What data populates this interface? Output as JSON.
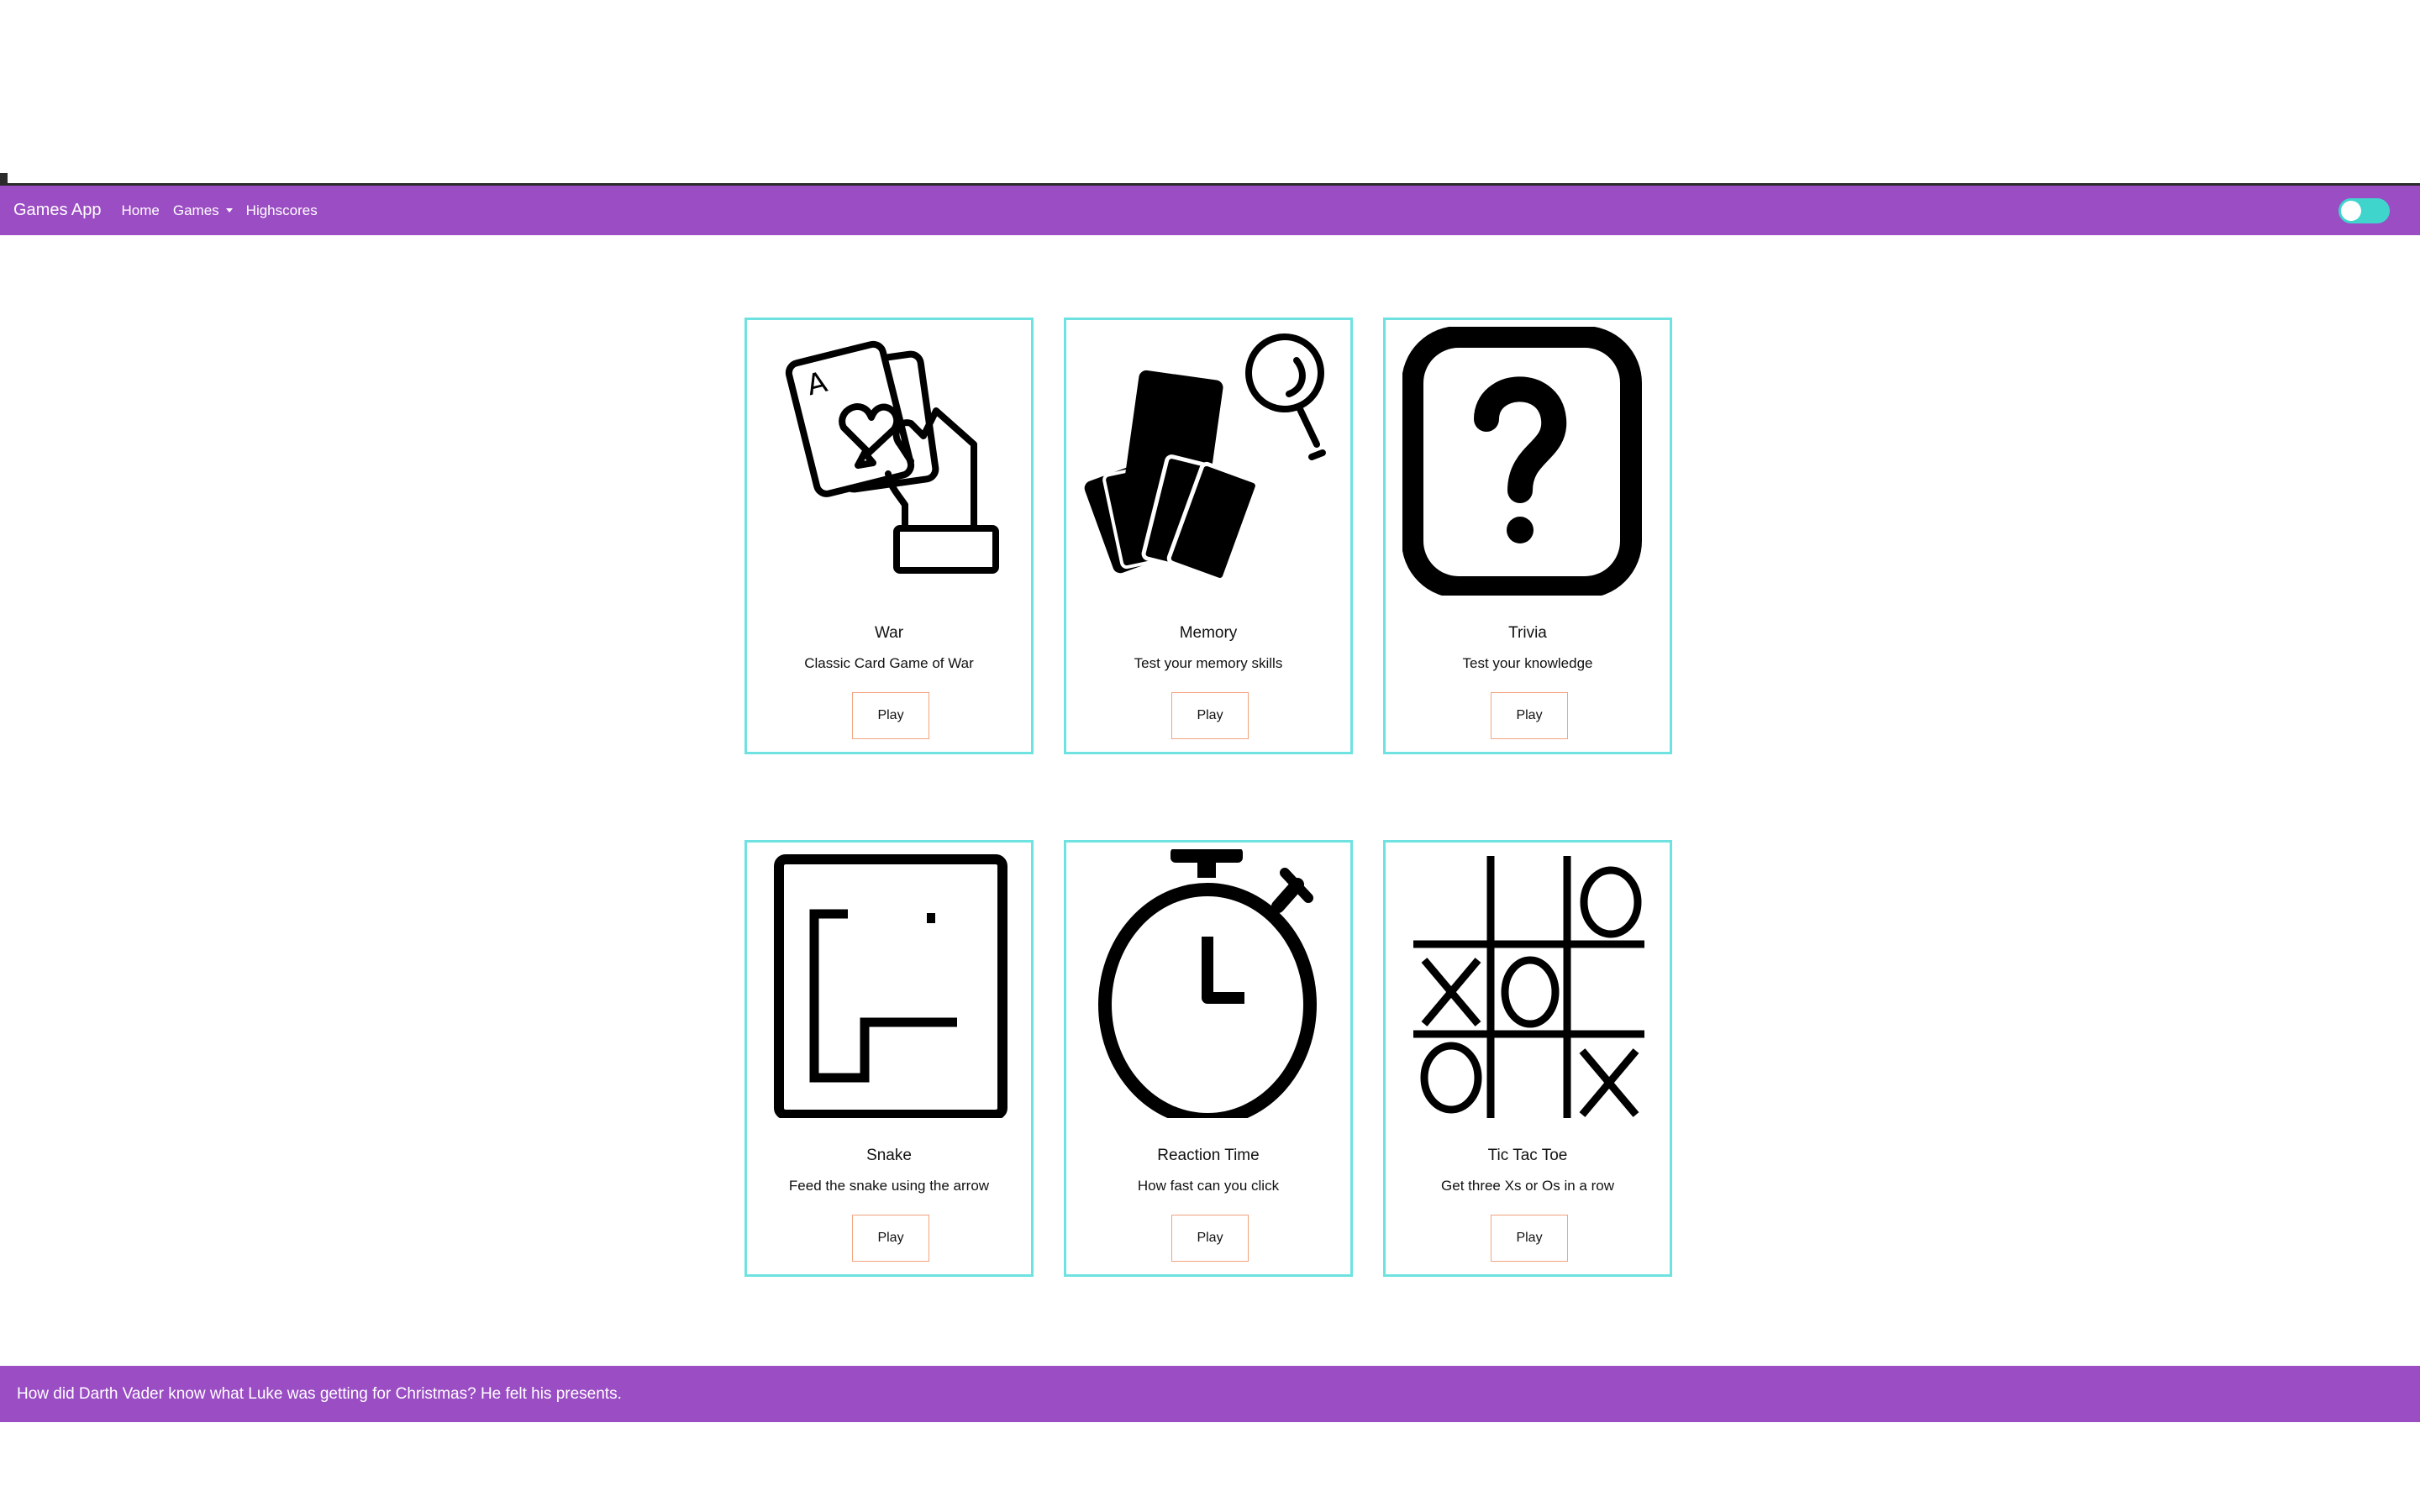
{
  "navbar": {
    "brand": "Games App",
    "links": [
      "Home",
      "Games",
      "Highscores"
    ],
    "accent_color": "#9b4dc4",
    "toggle_color": "#3fd4cc"
  },
  "cards": [
    {
      "title": "War",
      "description": "Classic Card Game of War",
      "button": "Play",
      "icon": "hand-holding-card-icon"
    },
    {
      "title": "Memory",
      "description": "Test your memory skills",
      "button": "Play",
      "icon": "cards-magnifier-icon"
    },
    {
      "title": "Trivia",
      "description": "Test your knowledge",
      "button": "Play",
      "icon": "question-mark-icon"
    },
    {
      "title": "Snake",
      "description": "Feed the snake using the arrow",
      "button": "Play",
      "icon": "snake-icon"
    },
    {
      "title": "Reaction Time",
      "description": "How fast can you click",
      "button": "Play",
      "icon": "stopwatch-icon"
    },
    {
      "title": "Tic Tac Toe",
      "description": "Get three Xs or Os in a row",
      "button": "Play",
      "icon": "tic-tac-toe-icon"
    }
  ],
  "footer": {
    "joke": "How did Darth Vader know what Luke was getting for Christmas? He felt his presents."
  }
}
